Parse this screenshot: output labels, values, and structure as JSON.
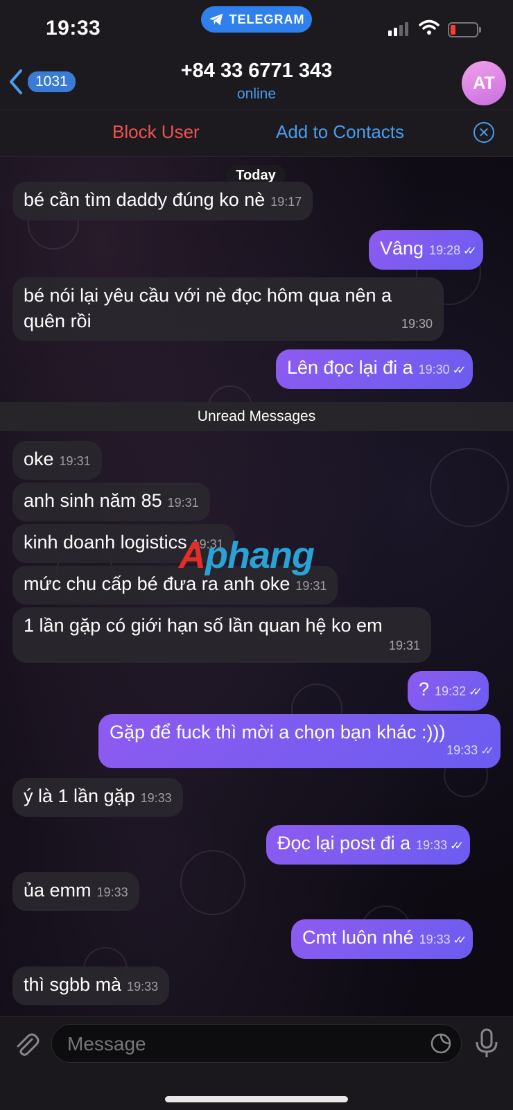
{
  "status_bar": {
    "time": "19:33",
    "app_pill": "TELEGRAM",
    "battery_level": 0.15
  },
  "header": {
    "back_count": "1031",
    "title": "+84 33 6771 343",
    "subtitle": "online",
    "avatar_initials": "AT"
  },
  "actions": {
    "block": "Block User",
    "add_contact": "Add to Contacts"
  },
  "chat": {
    "date_separator": "Today",
    "unread_label": "Unread Messages",
    "messages": [
      {
        "dir": "in",
        "text": "bé cần tìm daddy đúng ko nè",
        "time": "19:17"
      },
      {
        "dir": "out",
        "text": "Vâng",
        "time": "19:28",
        "read": true
      },
      {
        "dir": "in",
        "text": "bé nói lại yêu cầu với nè đọc hôm qua nên a quên rồi",
        "time": "19:30"
      },
      {
        "dir": "out",
        "text": "Lên đọc lại đi a",
        "time": "19:30",
        "read": true
      },
      {
        "dir": "in",
        "text": "oke",
        "time": "19:31"
      },
      {
        "dir": "in",
        "text": "anh sinh năm 85",
        "time": "19:31"
      },
      {
        "dir": "in",
        "text": "kinh doanh logistics",
        "time": "19:31"
      },
      {
        "dir": "in",
        "text": "mức chu cấp bé đưa ra anh oke",
        "time": "19:31"
      },
      {
        "dir": "in",
        "text": "1 lần gặp có giới hạn số lần quan hệ ko em",
        "time": "19:31"
      },
      {
        "dir": "out",
        "text": "?",
        "time": "19:32",
        "read": true
      },
      {
        "dir": "out",
        "text": "Gặp để fuck thì mời a chọn bạn khác :)))",
        "time": "19:33",
        "read": true
      },
      {
        "dir": "in",
        "text": "ý là 1 lần gặp",
        "time": "19:33"
      },
      {
        "dir": "out",
        "text": "Đọc lại post đi a",
        "time": "19:33",
        "read": true
      },
      {
        "dir": "in",
        "text": "ủa emm",
        "time": "19:33"
      },
      {
        "dir": "out",
        "text": "Cmt luôn nhé",
        "time": "19:33",
        "read": true
      },
      {
        "dir": "in",
        "text": "thì sgbb mà",
        "time": "19:33"
      }
    ]
  },
  "watermark": {
    "part1": "A",
    "part2": "phang"
  },
  "composer": {
    "placeholder": "Message"
  },
  "colors": {
    "accent": "#4a9cf0",
    "danger": "#ef5350",
    "outgoing_bubble": "#7b5cf0",
    "incoming_bubble": "#2a272e"
  }
}
